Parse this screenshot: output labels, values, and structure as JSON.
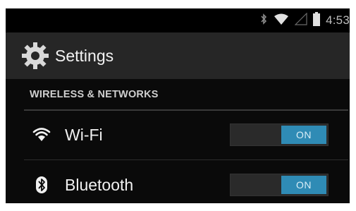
{
  "status_bar": {
    "time": "4:53",
    "icons": [
      "bluetooth-icon",
      "wifi-icon",
      "signal-icon",
      "battery-icon"
    ]
  },
  "action_bar": {
    "icon": "settings-gear-icon",
    "title": "Settings"
  },
  "section": {
    "title": "WIRELESS & NETWORKS"
  },
  "rows": [
    {
      "icon": "wifi-icon",
      "label": "Wi-Fi",
      "toggle_text": "ON",
      "enabled": true
    },
    {
      "icon": "bluetooth-icon",
      "label": "Bluetooth",
      "toggle_text": "ON",
      "enabled": true
    }
  ],
  "colors": {
    "accent": "#2f8bb5",
    "background": "#050505",
    "action_bar": "#262626"
  }
}
